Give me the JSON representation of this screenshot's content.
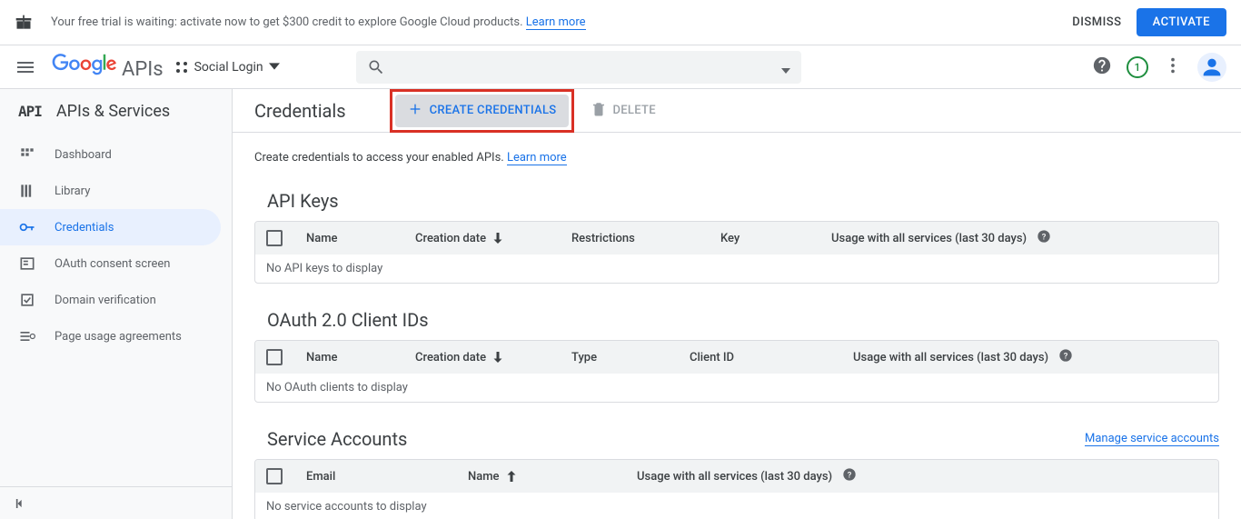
{
  "trial": {
    "message_prefix": "Your free trial is waiting: activate now to get $300 credit to explore Google Cloud products. ",
    "learn_more": "Learn more",
    "dismiss": "DISMISS",
    "activate": "ACTIVATE"
  },
  "appbar": {
    "logo_text": "APIs",
    "project_name": "Social Login",
    "trial_badge": "1"
  },
  "sidebar": {
    "title": "APIs & Services",
    "items": [
      {
        "label": "Dashboard"
      },
      {
        "label": "Library"
      },
      {
        "label": "Credentials"
      },
      {
        "label": "OAuth consent screen"
      },
      {
        "label": "Domain verification"
      },
      {
        "label": "Page usage agreements"
      }
    ]
  },
  "main": {
    "page_title": "Credentials",
    "create_label": "CREATE CREDENTIALS",
    "delete_label": "DELETE",
    "info_text": "Create credentials to access your enabled APIs. ",
    "learn_more": "Learn more"
  },
  "apikeys": {
    "title": "API Keys",
    "cols": {
      "name": "Name",
      "date": "Creation date",
      "restrictions": "Restrictions",
      "key": "Key",
      "usage": "Usage with all services (last 30 days)"
    },
    "empty": "No API keys to display"
  },
  "oauth": {
    "title": "OAuth 2.0 Client IDs",
    "cols": {
      "name": "Name",
      "date": "Creation date",
      "type": "Type",
      "client": "Client ID",
      "usage": "Usage with all services (last 30 days)"
    },
    "empty": "No OAuth clients to display"
  },
  "sa": {
    "title": "Service Accounts",
    "manage": "Manage service accounts",
    "cols": {
      "email": "Email",
      "name": "Name",
      "usage": "Usage with all services (last 30 days)"
    },
    "empty": "No service accounts to display"
  }
}
